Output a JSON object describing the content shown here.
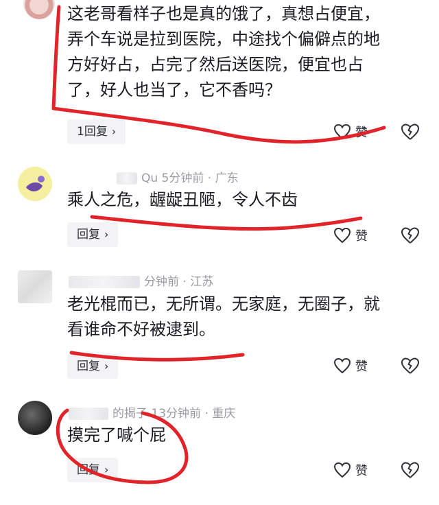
{
  "comments": [
    {
      "meta": "",
      "text_lines": [
        "这老哥看样子也是真的饿了，真想占便宜，",
        "弄个车说是拉到医院，中途找个偏僻点的地",
        "方好好占，占完了然后送医院，便宜也占",
        "了，好人也当了，它不香吗？"
      ],
      "reply_label": "1回复",
      "like_label": "赞"
    },
    {
      "meta": "Qu  5分钟前 · 广东",
      "text_lines": [
        "乘人之危，龌龊丑陋，令人不齿"
      ],
      "reply_label": "回复",
      "like_label": "赞"
    },
    {
      "meta": "分钟前 · 江苏",
      "text_lines": [
        "老光棍而已，无所谓。无家庭，无圈子，就",
        "看谁命不好被逮到。"
      ],
      "reply_label": "回复",
      "like_label": "赞"
    },
    {
      "meta": "的揭子  13分钟前 · 重庆",
      "text_lines": [
        "摸完了喊个屁"
      ],
      "reply_label": "回复",
      "like_label": "赞"
    }
  ],
  "icons": {
    "chevron": "›",
    "like": "heart-outline-icon",
    "dislike": "broken-heart-icon"
  },
  "colors": {
    "marker": "#e0242a",
    "meta_text": "#9a9ba1",
    "reply_bg": "#f3f3f5"
  }
}
